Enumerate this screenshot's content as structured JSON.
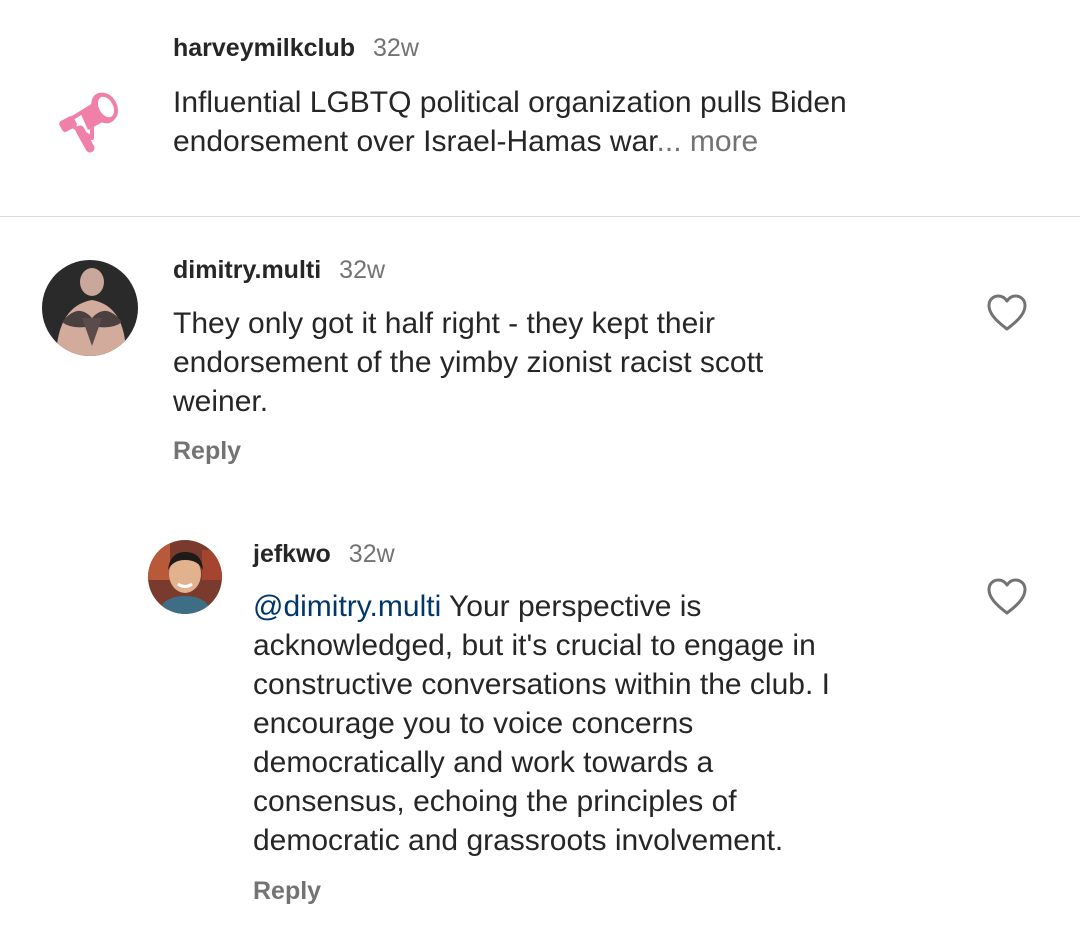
{
  "caption": {
    "username": "harveymilkclub",
    "time": "32w",
    "text_lines": [
      "Influential LGBTQ political organization pulls Biden",
      "endorsement over Israel-Hamas war"
    ],
    "ellipsis": "...",
    "more_label": "more",
    "icon": "megaphone-icon",
    "accent_color": "#f080a8"
  },
  "comments": [
    {
      "username": "dimitry.multi",
      "time": "32w",
      "text_lines": [
        "They only got it half right - they kept their",
        "endorsement of the yimby zionist racist scott",
        "weiner."
      ],
      "reply_label": "Reply",
      "like_icon": "heart-outline-icon"
    },
    {
      "username": "jefkwo",
      "time": "32w",
      "mention": "@dimitry.multi",
      "text_lines": [
        " Your perspective is",
        "acknowledged, but it's crucial to engage in",
        "constructive conversations within the club. I",
        "encourage you to voice concerns",
        "democratically and work towards a",
        "consensus, echoing the principles of",
        "democratic and grassroots involvement."
      ],
      "reply_label": "Reply",
      "like_icon": "heart-outline-icon"
    }
  ],
  "colors": {
    "mention": "#00376b",
    "secondary_text": "#737373",
    "divider": "#dbdbdb"
  }
}
